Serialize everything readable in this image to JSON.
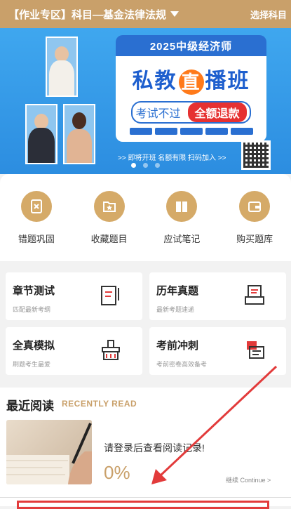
{
  "header": {
    "title": "【作业专区】科目—基金法律法规",
    "action": "选择科目"
  },
  "banner": {
    "year_title": "2025中级经济师",
    "big_left": "私教",
    "big_circle": "直",
    "big_right": "播班",
    "pill_text": "考试不过",
    "pill_highlight": "全额退款",
    "promo": ">> 即将开班 名额有限 扫码加入 >>"
  },
  "quick_actions": [
    {
      "label": "错题巩固",
      "icon": "wrong-questions-icon"
    },
    {
      "label": "收藏题目",
      "icon": "favorite-icon"
    },
    {
      "label": "应试笔记",
      "icon": "notes-icon"
    },
    {
      "label": "购买题库",
      "icon": "wallet-icon"
    }
  ],
  "cards": [
    {
      "title": "章节测试",
      "subtitle": "匹配最新考纲",
      "icon": "chapter-test-icon"
    },
    {
      "title": "历年真题",
      "subtitle": "最新考题速递",
      "icon": "past-papers-icon"
    },
    {
      "title": "全真模拟",
      "subtitle": "刷题考生最爱",
      "icon": "mock-exam-icon"
    },
    {
      "title": "考前冲刺",
      "subtitle": "考前密卷高效备考",
      "icon": "sprint-icon"
    }
  ],
  "recent": {
    "title": "最近阅读",
    "title_en": "RECENTLY READ",
    "message": "请登录后查看阅读记录!",
    "percent": "0%",
    "continue": "继续 Continue >"
  },
  "colors": {
    "gold": "#c9a06a",
    "blue": "#2a6fd1",
    "red": "#e23b3b"
  }
}
